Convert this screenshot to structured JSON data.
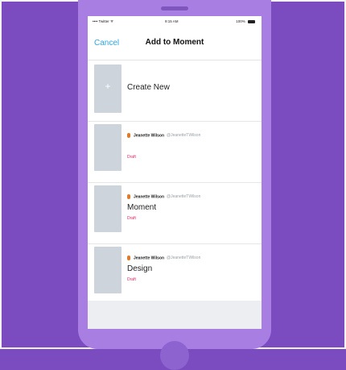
{
  "status_bar": {
    "carrier": "•••• Twitter ᯤ",
    "time": "9:15 AM",
    "battery": "100%"
  },
  "nav": {
    "cancel_label": "Cancel",
    "title": "Add to Moment"
  },
  "create_new": {
    "plus": "+",
    "label": "Create New"
  },
  "moments": [
    {
      "author": "Jeanette Wilson",
      "handle": "@JeanetteTWilson",
      "title": "",
      "status": "Draft"
    },
    {
      "author": "Jeanette Wilson",
      "handle": "@JeanetteTWilson",
      "title": "Moment",
      "status": "Draft"
    },
    {
      "author": "Jeanette Wilson",
      "handle": "@JeanetteTWilson",
      "title": "Design",
      "status": "Draft"
    }
  ]
}
